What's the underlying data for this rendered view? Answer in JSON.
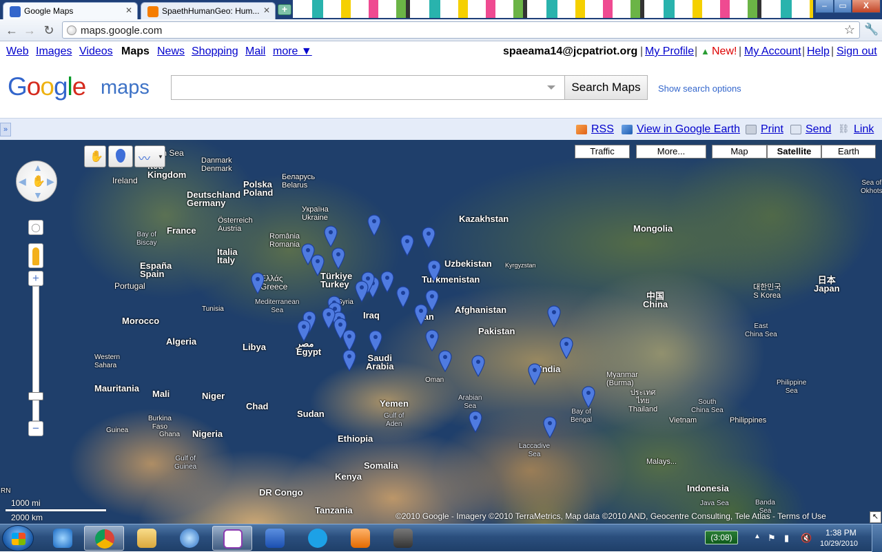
{
  "browser": {
    "tabs": [
      {
        "title": "Google Maps",
        "favicon_color": "#3366cc"
      },
      {
        "title": "SpaethHumanGeo: Hum...",
        "favicon_color": "#f57d00"
      }
    ],
    "url": "maps.google.com",
    "window_buttons": {
      "minimize": "–",
      "maximize": "▭",
      "close": "X"
    }
  },
  "gbar": {
    "left_links": [
      "Web",
      "Images",
      "Videos",
      "Maps",
      "News",
      "Shopping",
      "Mail",
      "more ▼"
    ],
    "selected": "Maps",
    "user_email": "spaeama14@jcpatriot.org",
    "right_links": [
      "My Profile",
      "New!",
      "My Account",
      "Help",
      "Sign out"
    ],
    "separator": "|"
  },
  "header": {
    "logo_google": "Google",
    "logo_maps": "maps",
    "search_value": "",
    "search_button": "Search Maps",
    "show_options": "Show search options"
  },
  "mapbar": {
    "collapse_label": "»",
    "links": [
      "RSS",
      "View in Google Earth",
      "Print",
      "Send",
      "Link"
    ]
  },
  "map": {
    "type_buttons": [
      "Traffic",
      "More...",
      "Map",
      "Satellite",
      "Earth"
    ],
    "selected_type": "Satellite",
    "scale_top": "1000 mi",
    "scale_bottom": "2000 km",
    "copyright": "©2010 Google - Imagery ©2010 TerraMetrics, Map data ©2010 AND, Geocentre Consulting, Tele Atlas - Terms of Use",
    "zoom_reset_label": "◯",
    "zoom_in_label": "+",
    "zoom_out_label": "−",
    "corner_label": "↖",
    "labels": {
      "north_sea": "th Sea",
      "united_kingdom": "ited\nKingdom",
      "ireland": "Ireland",
      "danmark": "Danmark\nDenmark",
      "belarus": "Беларусь\nBelarus",
      "polska": "Polska\nPoland",
      "deutschland": "Deutschland\nGermany",
      "ukraina": "Україна\nUkraine",
      "osterreich": "Österreich\nAustria",
      "france": "France",
      "bay_biscay": "Bay of\nBiscay",
      "romania": "România\nRomania",
      "italia": "Italia\nItaly",
      "espana": "España\nSpain",
      "portugal": "Portugal",
      "greece": "Ελλάς\nGreece",
      "turkiye": "Türkiye\nTurkey",
      "mediterranean": "Mediterranean\nSea",
      "tunisia": "Tunisia",
      "syria": "Syria",
      "morocco": "Morocco",
      "algeria": "Algeria",
      "libya": "Libya",
      "egypt": "مصر\nEgypt",
      "iraq": "Iraq",
      "iran": "Iran",
      "saudi": "Saudi\nArabia",
      "kazakhstan": "Kazakhstan",
      "uzbekistan": "Uzbekistan",
      "kyrgyzstan": "Kyrgyzstan",
      "turkmenistan": "Turkmenistan",
      "afghanistan": "Afghanistan",
      "pakistan": "Pakistan",
      "india": "India",
      "oman": "Oman",
      "arabian_sea": "Arabian\nSea",
      "yemen": "Yemen",
      "gulf_aden": "Gulf of\nAden",
      "laccadive": "Laccadive\nSea",
      "bay_bengal": "Bay of\nBengal",
      "mongolia": "Mongolia",
      "china": "中国\nChina",
      "korea": "대한민국\nS Korea",
      "japan": "日本\nJapan",
      "east_china_sea": "East\nChina Sea",
      "myanmar": "Myanmar\n(Burma)",
      "thailand": "ประเทศ\nไทย\nThailand",
      "philippine_sea": "Philippine\nSea",
      "south_china_sea": "South\nChina Sea",
      "philippines": "Philippines",
      "vietnam": "Vietnam",
      "malaysia": "Malays...",
      "indonesia": "Indonesia",
      "java_sea": "Java Sea",
      "banda_sea": "Banda\nSea",
      "sea_okhotsk": "Sea of\nOkhots",
      "western_sahara": "Western\nSahara",
      "mauritania": "Mauritania",
      "mali": "Mali",
      "niger": "Niger",
      "chad": "Chad",
      "sudan": "Sudan",
      "ethiopia": "Ethiopia",
      "somalia": "Somalia",
      "kenya": "Kenya",
      "tanzania": "Tanzania",
      "dr_congo": "DR Congo",
      "nigeria": "Nigeria",
      "burkina": "Burkina\nFaso",
      "guinea": "Guinea",
      "ghana": "Ghana",
      "gulf_guinea": "Gulf of\nGuinea",
      "rn": "RN"
    }
  },
  "taskbar": {
    "battery": "(3:08)",
    "time": "1:38 PM",
    "date": "10/29/2010",
    "apps": [
      "internet-explorer",
      "chrome",
      "file-explorer",
      "itunes",
      "onenote",
      "word",
      "skype",
      "media-player",
      "network-app"
    ],
    "active_app": "chrome"
  }
}
